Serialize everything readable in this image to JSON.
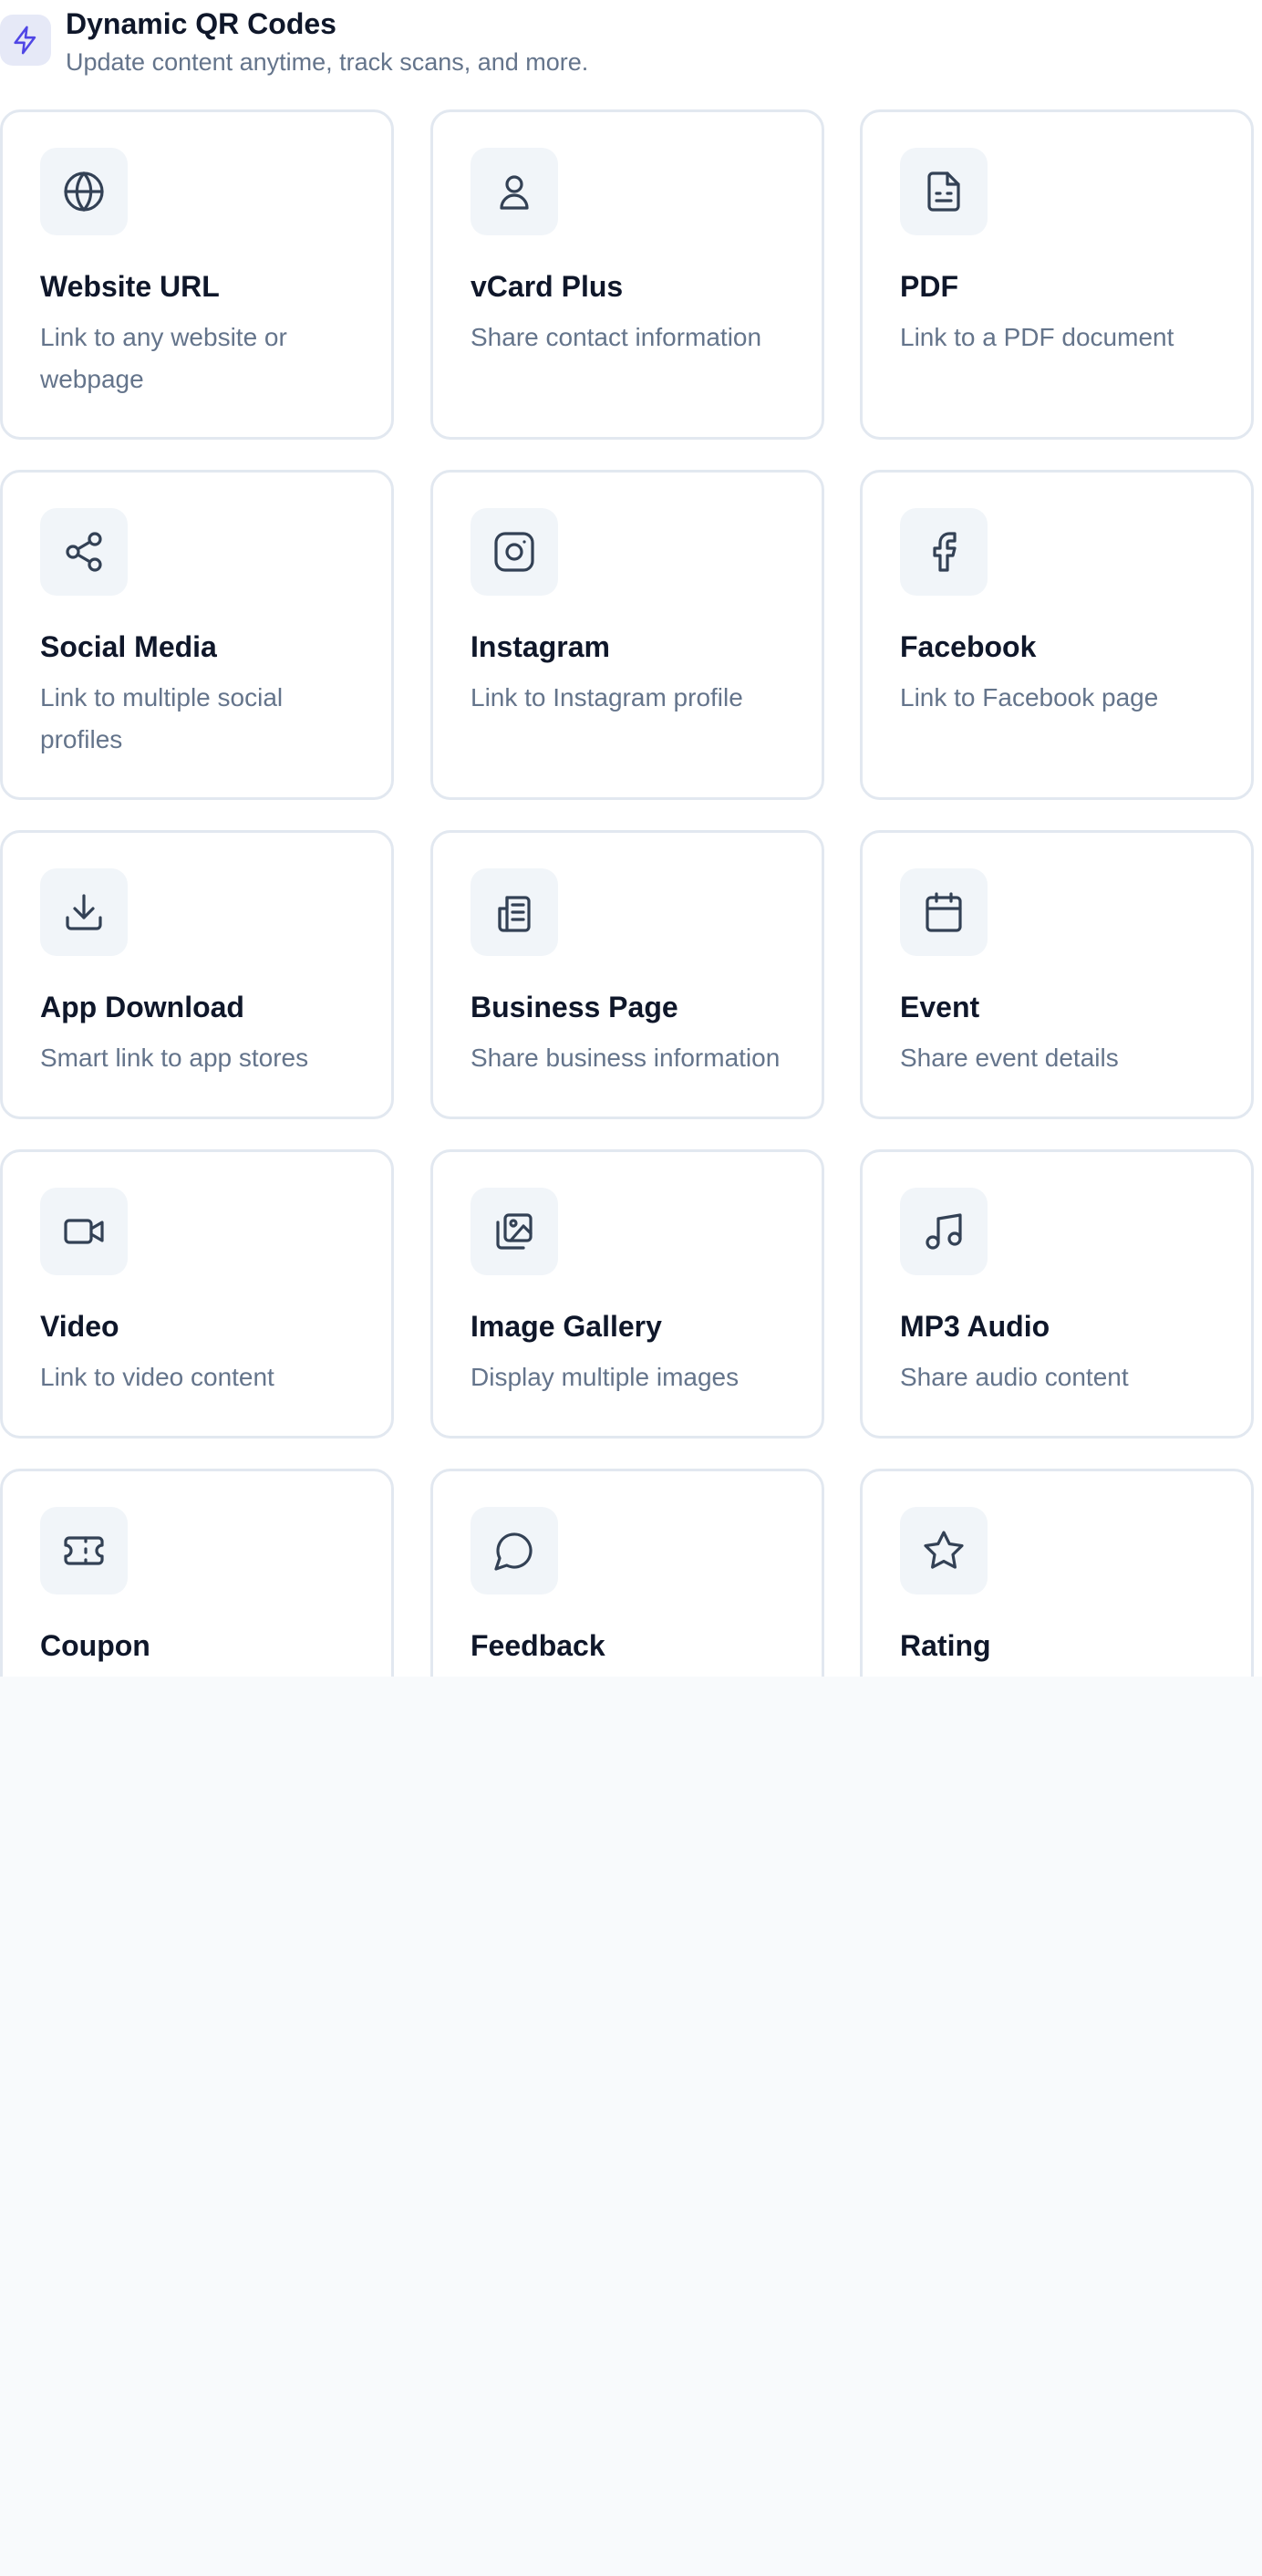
{
  "header": {
    "icon": "lightning-icon",
    "title": "Dynamic QR Codes",
    "subtitle": "Update content anytime, track scans, and more."
  },
  "colors": {
    "accent": "#4f46e5",
    "card_border": "#e2e8f0",
    "icon_bg": "#f1f5f9",
    "title": "#0f172a",
    "muted": "#64748b"
  },
  "cards": [
    {
      "icon": "globe-icon",
      "title": "Website URL",
      "description": "Link to any website or webpage"
    },
    {
      "icon": "user-icon",
      "title": "vCard Plus",
      "description": "Share contact information"
    },
    {
      "icon": "document-icon",
      "title": "PDF",
      "description": "Link to a PDF document"
    },
    {
      "icon": "share-icon",
      "title": "Social Media",
      "description": "Link to multiple social profiles"
    },
    {
      "icon": "instagram-icon",
      "title": "Instagram",
      "description": "Link to Instagram profile"
    },
    {
      "icon": "facebook-icon",
      "title": "Facebook",
      "description": "Link to Facebook page"
    },
    {
      "icon": "download-icon",
      "title": "App Download",
      "description": "Smart link to app stores"
    },
    {
      "icon": "newspaper-icon",
      "title": "Business Page",
      "description": "Share business information"
    },
    {
      "icon": "calendar-icon",
      "title": "Event",
      "description": "Share event details"
    },
    {
      "icon": "video-icon",
      "title": "Video",
      "description": "Link to video content"
    },
    {
      "icon": "image-gallery-icon",
      "title": "Image Gallery",
      "description": "Display multiple images"
    },
    {
      "icon": "music-icon",
      "title": "MP3 Audio",
      "description": "Share audio content"
    },
    {
      "icon": "ticket-icon",
      "title": "Coupon",
      "description": ""
    },
    {
      "icon": "message-icon",
      "title": "Feedback",
      "description": ""
    },
    {
      "icon": "star-icon",
      "title": "Rating",
      "description": ""
    }
  ]
}
